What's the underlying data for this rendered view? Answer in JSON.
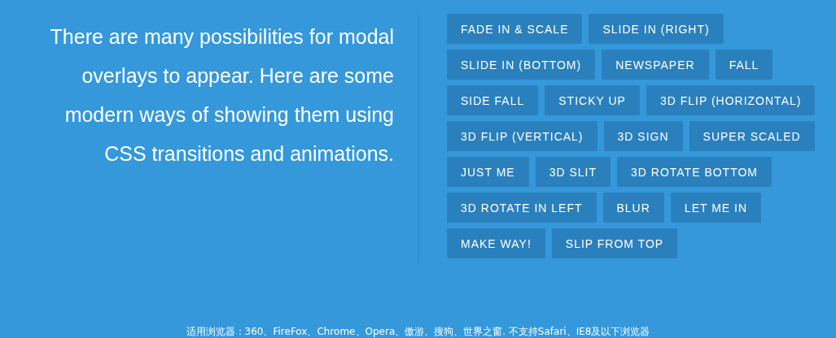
{
  "intro": "There are many possibilities for modal overlays to appear. Here are some modern ways of showing them using CSS transitions and animations.",
  "buttons": [
    "FADE IN & SCALE",
    "SLIDE IN (RIGHT)",
    "SLIDE IN (BOTTOM)",
    "NEWSPAPER",
    "FALL",
    "SIDE FALL",
    "STICKY UP",
    "3D FLIP (HORIZONTAL)",
    "3D FLIP (VERTICAL)",
    "3D SIGN",
    "SUPER SCALED",
    "JUST ME",
    "3D SLIT",
    "3D ROTATE BOTTOM",
    "3D ROTATE IN LEFT",
    "BLUR",
    "LET ME IN",
    "MAKE WAY!",
    "SLIP FROM TOP"
  ],
  "footer": "适用浏览器：360、FireFox、Chrome、Opera、傲游、搜狗、世界之窗. 不支持Safari、IE8及以下浏览器"
}
